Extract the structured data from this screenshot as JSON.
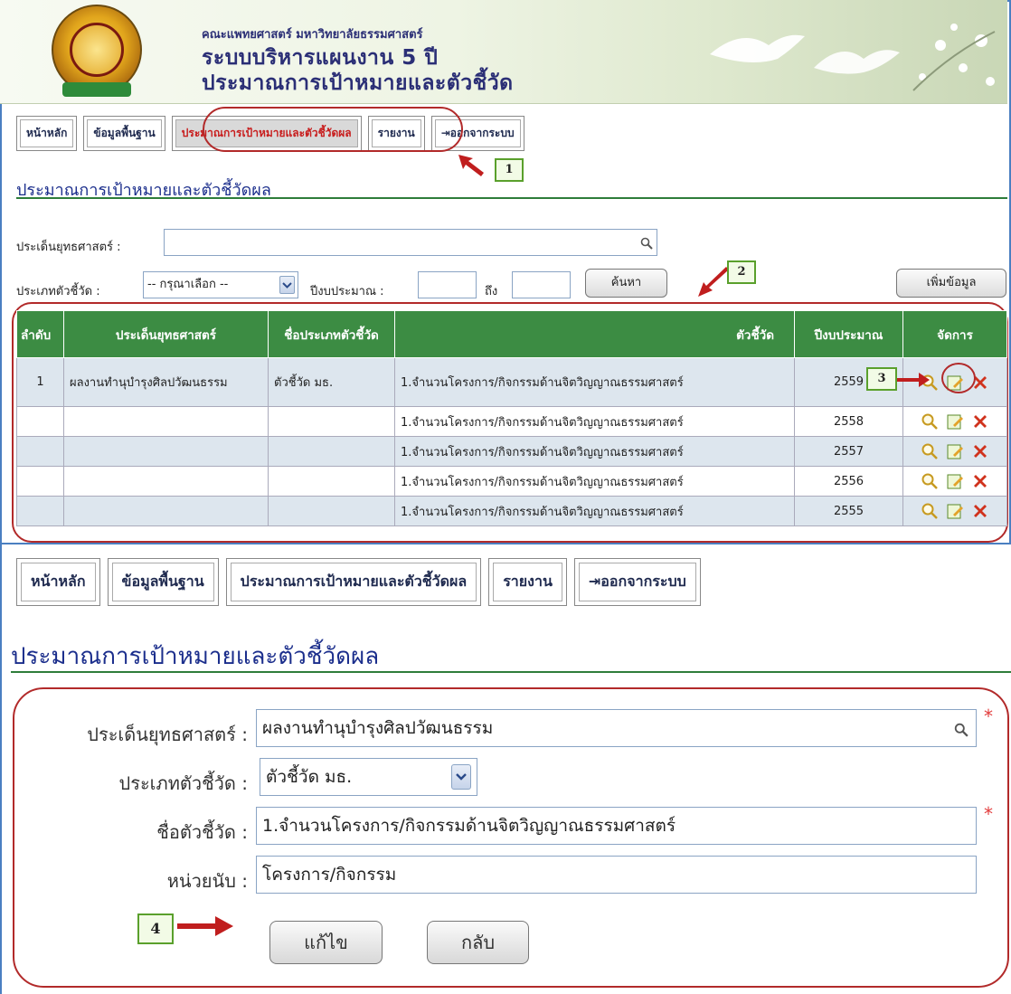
{
  "banner": {
    "org": "คณะแพทยศาสตร์ มหาวิทยาลัยธรรมศาสตร์",
    "system_line1": "ระบบบริหารแผนงาน 5 ปี",
    "system_line2": "ประมาณการเป้าหมายและตัวชี้วัด"
  },
  "nav": {
    "home": "หน้าหลัก",
    "basic": "ข้อมูลพื้นฐาน",
    "targets": "ประมาณการเป้าหมายและตัวชี้วัดผล",
    "report": "รายงาน",
    "logout": "ออกจากระบบ"
  },
  "list_page": {
    "title": "ประมาณการเป้าหมายและตัวชี้วัดผล",
    "filter_strategy_label": "ประเด็นยุทธศาสตร์ :",
    "filter_type_label": "ประเภทตัวชี้วัด :",
    "filter_type_value": "-- กรุณาเลือก --",
    "filter_year_label": "ปีงบประมาณ :",
    "filter_to_label": "ถึง",
    "search_button": "ค้นหา",
    "add_button": "เพิ่มข้อมูล",
    "columns": [
      "ลำดับ",
      "ประเด็นยุทธศาสตร์",
      "ชื่อประเภทตัวชี้วัด",
      "ตัวชี้วัด",
      "ปีงบประมาณ",
      "จัดการ"
    ],
    "rows": [
      {
        "no": "1",
        "strategy": "ผลงานทำนุบำรุงศิลปวัฒนธรรม",
        "type": "ตัวชี้วัด มธ.",
        "indicator": "1.จำนวนโครงการ/กิจกรรมด้านจิตวิญญาณธรรมศาสตร์",
        "year": "2559"
      },
      {
        "no": "",
        "strategy": "",
        "type": "",
        "indicator": "1.จำนวนโครงการ/กิจกรรมด้านจิตวิญญาณธรรมศาสตร์",
        "year": "2558"
      },
      {
        "no": "",
        "strategy": "",
        "type": "",
        "indicator": "1.จำนวนโครงการ/กิจกรรมด้านจิตวิญญาณธรรมศาสตร์",
        "year": "2557"
      },
      {
        "no": "",
        "strategy": "",
        "type": "",
        "indicator": "1.จำนวนโครงการ/กิจกรรมด้านจิตวิญญาณธรรมศาสตร์",
        "year": "2556"
      },
      {
        "no": "",
        "strategy": "",
        "type": "",
        "indicator": "1.จำนวนโครงการ/กิจกรรมด้านจิตวิญญาณธรรมศาสตร์",
        "year": "2555"
      }
    ]
  },
  "callouts": {
    "c1": "1",
    "c2": "2",
    "c3": "3",
    "c4": "4"
  },
  "edit_page": {
    "title": "ประมาณการเป้าหมายและตัวชี้วัดผล",
    "strategy_label": "ประเด็นยุทธศาสตร์ :",
    "strategy_value": "ผลงานทำนุบำรุงศิลปวัฒนธรรม",
    "type_label": "ประเภทตัวชี้วัด :",
    "type_value": "ตัวชี้วัด มธ.",
    "name_label": "ชื่อตัวชี้วัด :",
    "name_value": "1.จำนวนโครงการ/กิจกรรมด้านจิตวิญญาณธรรมศาสตร์",
    "unit_label": "หน่วยนับ :",
    "unit_value": "โครงการ/กิจกรรม",
    "required_mark": "*",
    "edit_button": "แก้ไข",
    "back_button": "กลับ"
  },
  "colors": {
    "nav_active": "#c81d1d",
    "header_green": "#3c8c43",
    "title_blue": "#1b2e8c",
    "highlight": "#b22a2a"
  }
}
